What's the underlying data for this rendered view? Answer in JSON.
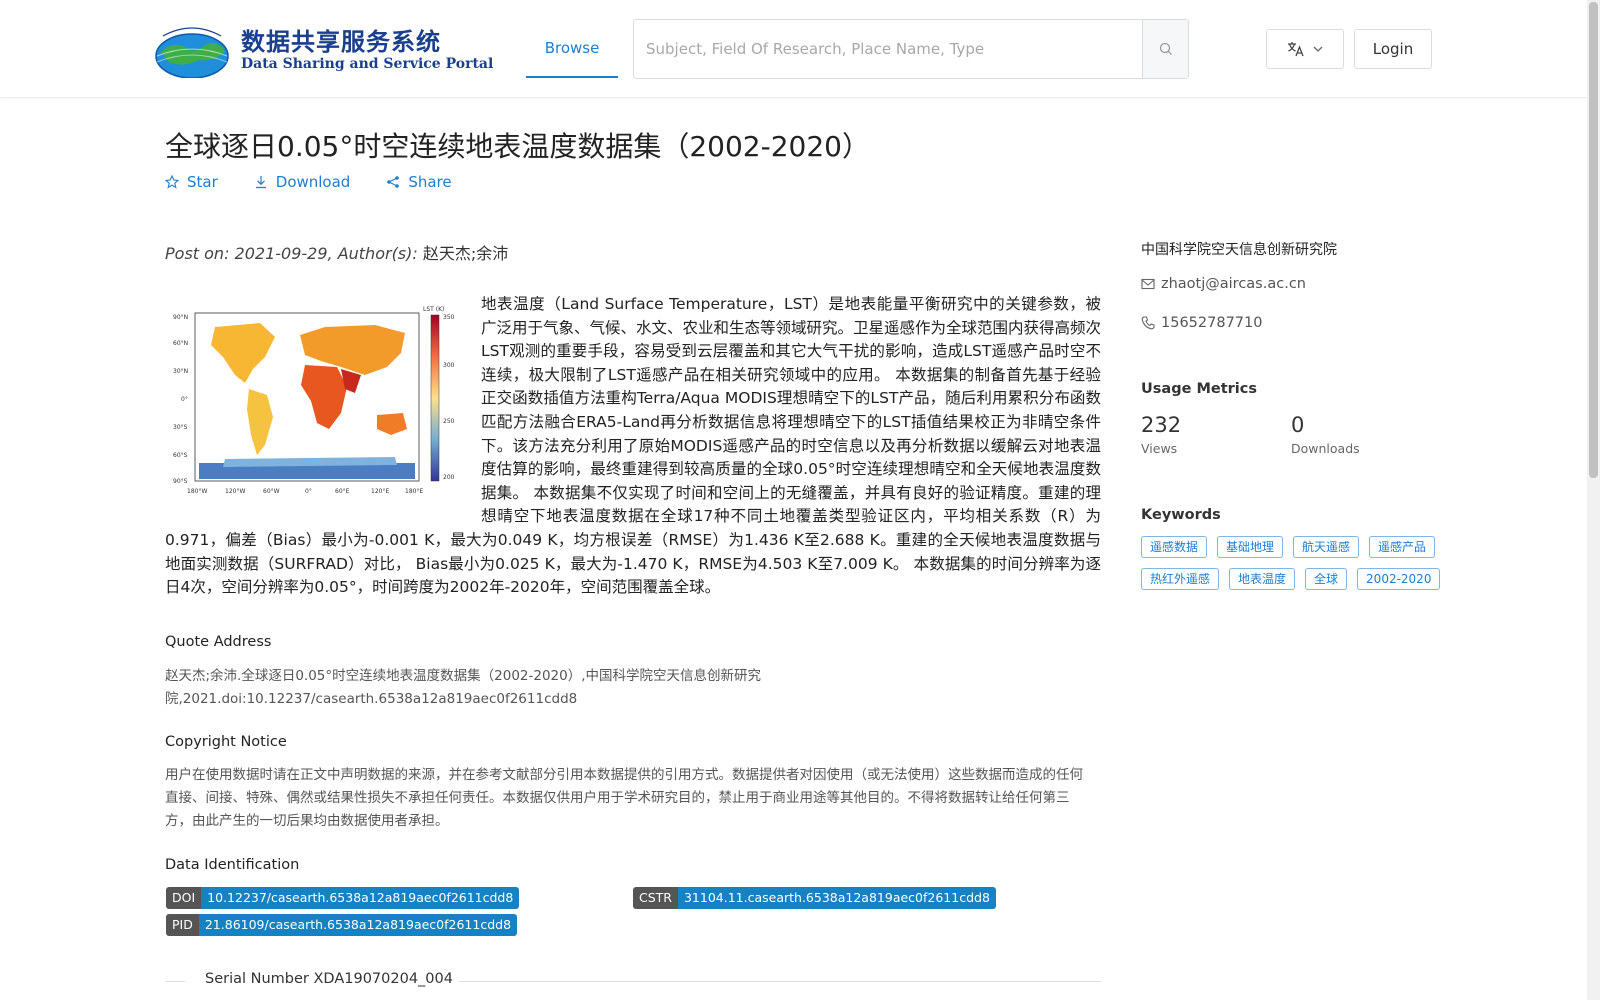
{
  "header": {
    "logo_cn": "数据共享服务系统",
    "logo_en": "Data Sharing and Service Portal",
    "nav_browse": "Browse",
    "search_placeholder": "Subject, Field Of Research, Place Name, Type",
    "login_label": "Login"
  },
  "dataset": {
    "title": "全球逐日0.05°时空连续地表温度数据集（2002-2020）",
    "actions": {
      "star": "Star",
      "download": "Download",
      "share": "Share"
    },
    "post_prefix": "Post on: 2021-09-29, Author(s): ",
    "authors": "赵天杰;余沛",
    "abstract": "地表温度（Land Surface Temperature，LST）是地表能量平衡研究中的关键参数，被广泛用于气象、气候、水文、农业和生态等领域研究。卫星遥感作为全球范围内获得高频次LST观测的重要手段，容易受到云层覆盖和其它大气干扰的影响，造成LST遥感产品时空不连续，极大限制了LST遥感产品在相关研究领域中的应用。 本数据集的制备首先基于经验正交函数插值方法重构Terra/Aqua MODIS理想晴空下的LST产品，随后利用累积分布函数匹配方法融合ERA5-Land再分析数据信息将理想晴空下的LST插值结果校正为非晴空条件下。该方法充分利用了原始MODIS遥感产品的时空信息以及再分析数据以缓解云对地表温度估算的影响，最终重建得到较高质量的全球0.05°时空连续理想晴空和全天候地表温度数据集。 本数据集不仅实现了时间和空间上的无缝覆盖，并具有良好的验证精度。重建的理想晴空下地表温度数据在全球17种不同土地覆盖类型验证区内，平均相关系数（R）为0.971，偏差（Bias）最小为-0.001 K，最大为0.049 K，均方根误差（RMSE）为1.436 K至2.688 K。重建的全天候地表温度数据与地面实测数据（SURFRAD）对比， Bias最小为0.025 K，最大为-1.470 K，RMSE为4.503 K至7.009 K。 本数据集的时间分辨率为逐日4次，空间分辨率为0.05°，时间跨度为2002年-2020年，空间范围覆盖全球。"
  },
  "map_thumb": {
    "colorbar_title": "LST (K)",
    "colorbar_ticks": [
      "350",
      "300",
      "250",
      "200"
    ],
    "lat_labels": [
      "90°N",
      "60°N",
      "30°N",
      "0°",
      "30°S",
      "60°S",
      "90°S"
    ],
    "lon_labels": [
      "180°W",
      "120°W",
      "60°W",
      "0°",
      "60°E",
      "120°E",
      "180°E"
    ]
  },
  "quote": {
    "heading": "Quote Address",
    "text": "赵天杰;余沛.全球逐日0.05°时空连续地表温度数据集（2002-2020）,中国科学院空天信息创新研究院,2021.doi:10.12237/casearth.6538a12a819aec0f2611cdd8"
  },
  "copyright": {
    "heading": "Copyright Notice",
    "text": "用户在使用数据时请在正文中声明数据的来源，并在参考文献部分引用本数据提供的引用方式。数据提供者对因使用（或无法使用）这些数据而造成的任何直接、间接、特殊、偶然或结果性损失不承担任何责任。本数据仅供用户用于学术研究目的，禁止用于商业用途等其他目的。不得将数据转让给任何第三方，由此产生的一切后果均由数据使用者承担。"
  },
  "identification": {
    "heading": "Data Identification",
    "doi_key": "DOI",
    "doi_value": "10.12237/casearth.6538a12a819aec0f2611cdd8",
    "cstr_key": "CSTR",
    "cstr_value": "31104.11.casearth.6538a12a819aec0f2611cdd8",
    "pid_key": "PID",
    "pid_value": "21.86109/casearth.6538a12a819aec0f2611cdd8"
  },
  "serial": "Serial Number XDA19070204_004",
  "sidebar": {
    "organization": "中国科学院空天信息创新研究院",
    "email": "zhaotj@aircas.ac.cn",
    "phone": "15652787710",
    "metrics_heading": "Usage Metrics",
    "views_value": "232",
    "views_label": "Views",
    "downloads_value": "0",
    "downloads_label": "Downloads",
    "keywords_heading": "Keywords",
    "keywords": [
      "遥感数据",
      "基础地理",
      "航天遥感",
      "遥感产品",
      "热红外遥感",
      "地表温度",
      "全球",
      "2002-2020"
    ]
  },
  "colors": {
    "accent": "#1c7fd1",
    "badge_value": "#1582c4",
    "badge_key": "#555555"
  }
}
